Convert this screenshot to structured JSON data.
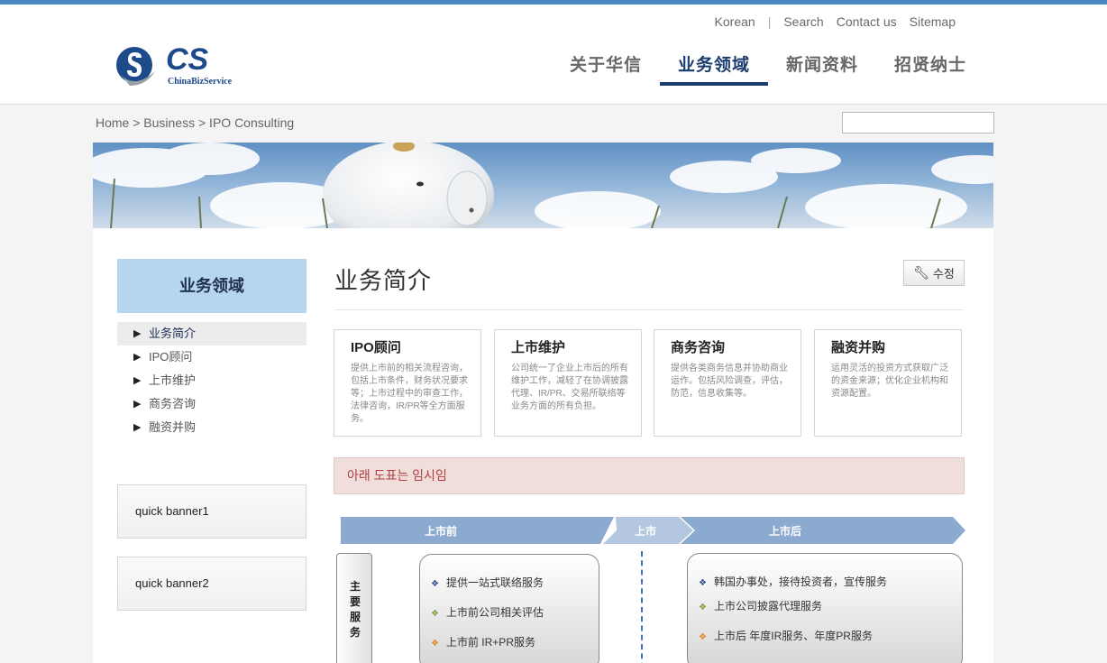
{
  "utility_nav": [
    "Korean",
    "Search",
    "Contact us",
    "Sitemap"
  ],
  "logo": {
    "mark": "CS",
    "sub": "ChinaBizService"
  },
  "gnb": [
    {
      "label": "关于华信",
      "active": false
    },
    {
      "label": "业务领域",
      "active": true
    },
    {
      "label": "新闻资料",
      "active": false
    },
    {
      "label": "招贤纳士",
      "active": false
    }
  ],
  "breadcrumb": "Home > Business > IPO Consulting",
  "search": {
    "value": ""
  },
  "lnb": {
    "title": "业务领域",
    "items": [
      {
        "label": "业务简介",
        "active": true
      },
      {
        "label": "IPO顾问",
        "active": false
      },
      {
        "label": "上市维护",
        "active": false
      },
      {
        "label": "商务咨询",
        "active": false
      },
      {
        "label": "融资并购",
        "active": false
      }
    ]
  },
  "quick_banners": [
    "quick banner1",
    "quick banner2"
  ],
  "page_title": "业务简介",
  "edit_button": "수정",
  "cards": [
    {
      "title": "IPO顾问",
      "desc": "提供上市前的相关流程咨询，包括上市条件，财务状况要求等；上市过程中的审查工作，法律咨询，IR/PR等全方面服务。"
    },
    {
      "title": "上市维护",
      "desc": "公司统一了企业上市后的所有维护工作，减轻了在协调披露代理、IR/PR、交易所联络等业务方面的所有负担。"
    },
    {
      "title": "商务咨询",
      "desc": "提供各类商务信息并协助商业运作。包括风险调查，评估，防范，信息收集等。"
    },
    {
      "title": "融资并购",
      "desc": "运用灵活的投资方式获取广泛的资金来源；优化企业机构和资源配置。"
    }
  ],
  "notice": "아래 도표는 임시임",
  "diagram": {
    "stages": [
      "上市前",
      "上市",
      "上市后"
    ],
    "side_label": [
      "主",
      "要",
      "服",
      "务"
    ],
    "pre_items": [
      {
        "text": "提供一站式联络服务",
        "color": "#2b4f8c"
      },
      {
        "text": "上市前公司相关评估",
        "color": "#7aa032"
      },
      {
        "text": "上市前 IR+PR服务",
        "color": "#e0852c"
      }
    ],
    "post_items": [
      {
        "text": "韩国办事处，接待投资者，宣传服务",
        "color": "#2b4f8c"
      },
      {
        "text": "上市公司披露代理服务",
        "color": "#7aa032"
      },
      {
        "text": "上市后 年度IR服务、年度PR服务",
        "color": "#e0852c"
      }
    ]
  }
}
